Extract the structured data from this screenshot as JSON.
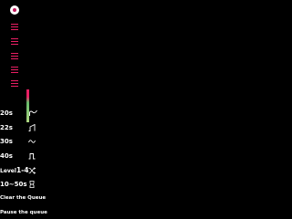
{
  "app": {
    "logo_icon": "record-circle-icon",
    "accent_color": "#e91e63"
  },
  "queue": {
    "items": [
      {
        "icon": "queue-lines-icon"
      },
      {
        "icon": "queue-lines-icon"
      },
      {
        "icon": "queue-lines-icon"
      },
      {
        "icon": "queue-lines-icon"
      },
      {
        "icon": "queue-lines-icon"
      },
      {
        "icon": "queue-lines-icon"
      }
    ]
  },
  "level_meter": {
    "colors": [
      "#e91e63",
      "#66bb6a",
      "#aed581"
    ]
  },
  "presets": [
    {
      "label": "20s",
      "icon": "pluck-wave-icon"
    },
    {
      "label": "22s",
      "icon": "ramp-wave-icon"
    },
    {
      "label": "30s",
      "icon": "sine-wave-icon"
    },
    {
      "label": "40s",
      "icon": "square-wave-icon"
    },
    {
      "label_prefix": "Level",
      "label_main": "1-4",
      "icon": "shuffle-icon"
    },
    {
      "label": "10~50s",
      "icon": "timer-icon"
    }
  ],
  "actions": {
    "clear_queue": "Clear the Queue",
    "pause_queue": "Pause the queue"
  }
}
